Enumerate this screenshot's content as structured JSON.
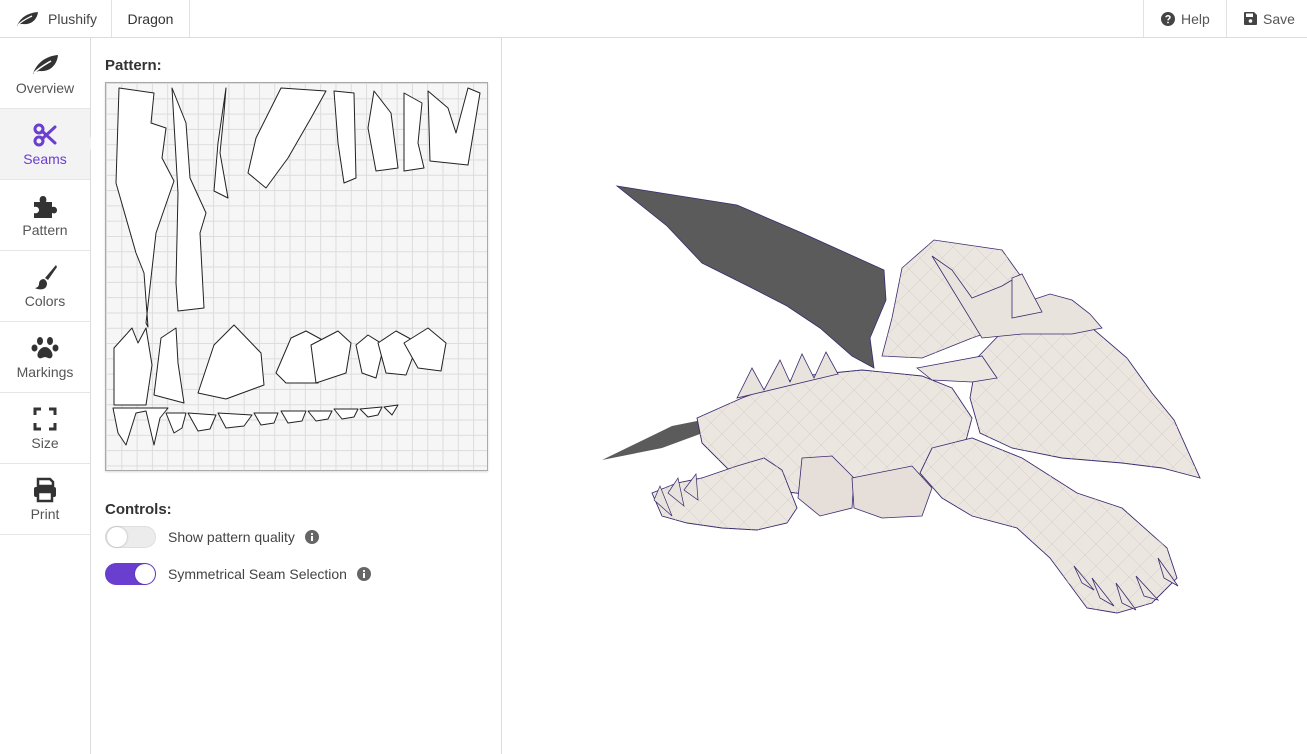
{
  "app": {
    "brand_name": "Plushify",
    "document_title": "Dragon",
    "accent_color": "#6a3fcf"
  },
  "topbar": {
    "help_label": "Help",
    "save_label": "Save"
  },
  "sidebar": {
    "items": [
      {
        "label": "Overview",
        "icon": "leaf-icon",
        "active": false
      },
      {
        "label": "Seams",
        "icon": "scissors-icon",
        "active": true
      },
      {
        "label": "Pattern",
        "icon": "puzzle-icon",
        "active": false
      },
      {
        "label": "Colors",
        "icon": "paintbrush-icon",
        "active": false
      },
      {
        "label": "Markings",
        "icon": "paw-icon",
        "active": false
      },
      {
        "label": "Size",
        "icon": "expand-icon",
        "active": false
      },
      {
        "label": "Print",
        "icon": "printer-icon",
        "active": false
      }
    ]
  },
  "panel": {
    "pattern_label": "Pattern:",
    "controls_label": "Controls:",
    "controls": [
      {
        "label": "Show pattern quality",
        "enabled": false,
        "info_icon": "info-icon"
      },
      {
        "label": "Symmetrical Seam Selection",
        "enabled": true,
        "info_icon": "info-icon"
      }
    ]
  },
  "viewport": {
    "model": "dragon-3d-model"
  }
}
